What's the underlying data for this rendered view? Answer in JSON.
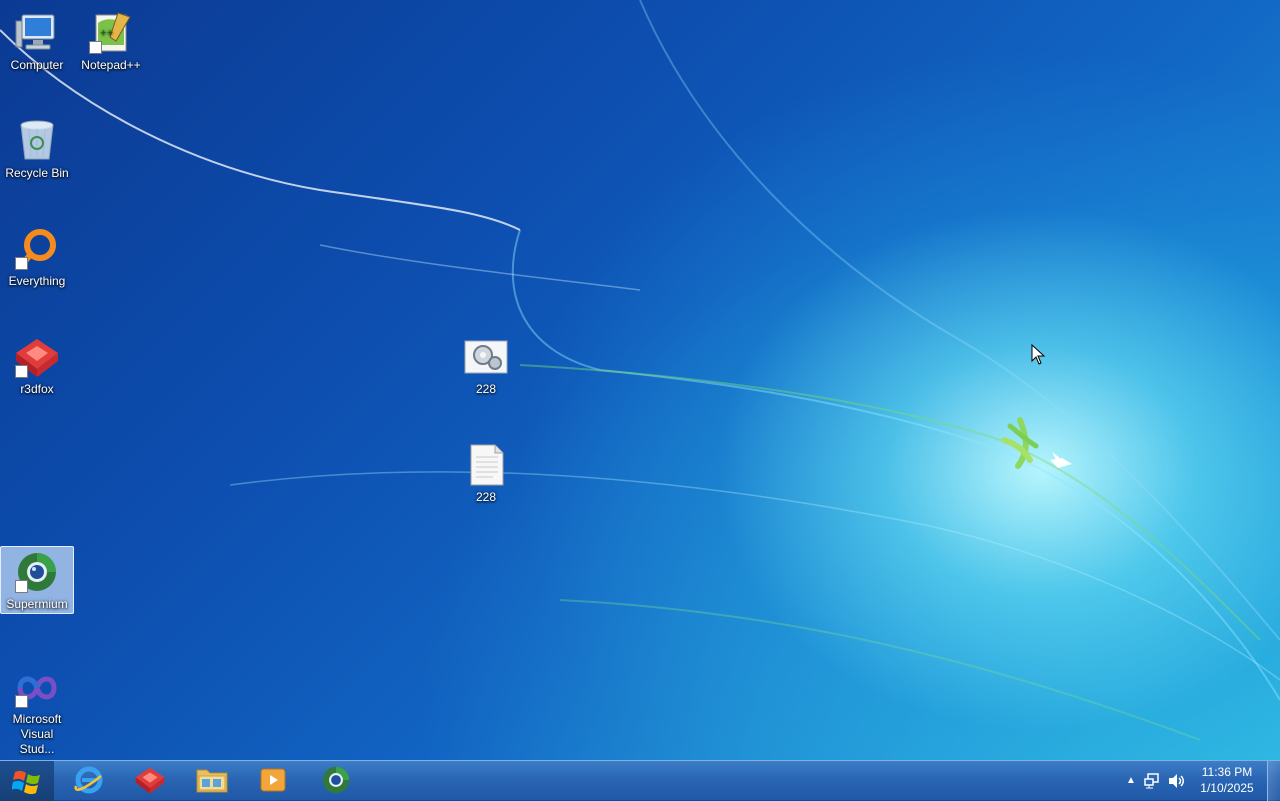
{
  "desktop_icons": [
    {
      "label": "Computer",
      "icon": "computer-icon"
    },
    {
      "label": "Notepad++",
      "icon": "notepad-plus-plus-icon",
      "shortcut": true
    },
    {
      "label": "Recycle Bin",
      "icon": "recycle-bin-icon"
    },
    {
      "label": "Everything",
      "icon": "everything-search-icon",
      "shortcut": true
    },
    {
      "label": "r3dfox",
      "icon": "r3dfox-icon",
      "shortcut": true
    },
    {
      "label": "228",
      "icon": "settings-file-icon"
    },
    {
      "label": "228",
      "icon": "text-file-icon"
    },
    {
      "label": "Supermium",
      "icon": "supermium-icon",
      "shortcut": true,
      "selected": true
    },
    {
      "label": "Microsoft Visual Stud...",
      "icon": "visual-studio-icon",
      "shortcut": true
    }
  ],
  "taskbar": {
    "start": {
      "icon": "windows-logo-icon"
    },
    "pinned": [
      {
        "name": "Internet Explorer",
        "icon": "internet-explorer-icon"
      },
      {
        "name": "r3dfox",
        "icon": "r3dfox-icon"
      },
      {
        "name": "File Explorer",
        "icon": "folder-icon"
      },
      {
        "name": "Media Player",
        "icon": "media-player-icon"
      },
      {
        "name": "Supermium",
        "icon": "supermium-icon"
      }
    ],
    "tray": {
      "icons": [
        "show-hidden-icons-arrow",
        "network-icon",
        "volume-icon"
      ],
      "time": "11:36 PM",
      "date": "1/10/2025"
    }
  },
  "colors": {
    "taskbar": "#2a66b4",
    "desktop_dark": "#0b3a93",
    "desktop_light": "#2bb1e0"
  }
}
